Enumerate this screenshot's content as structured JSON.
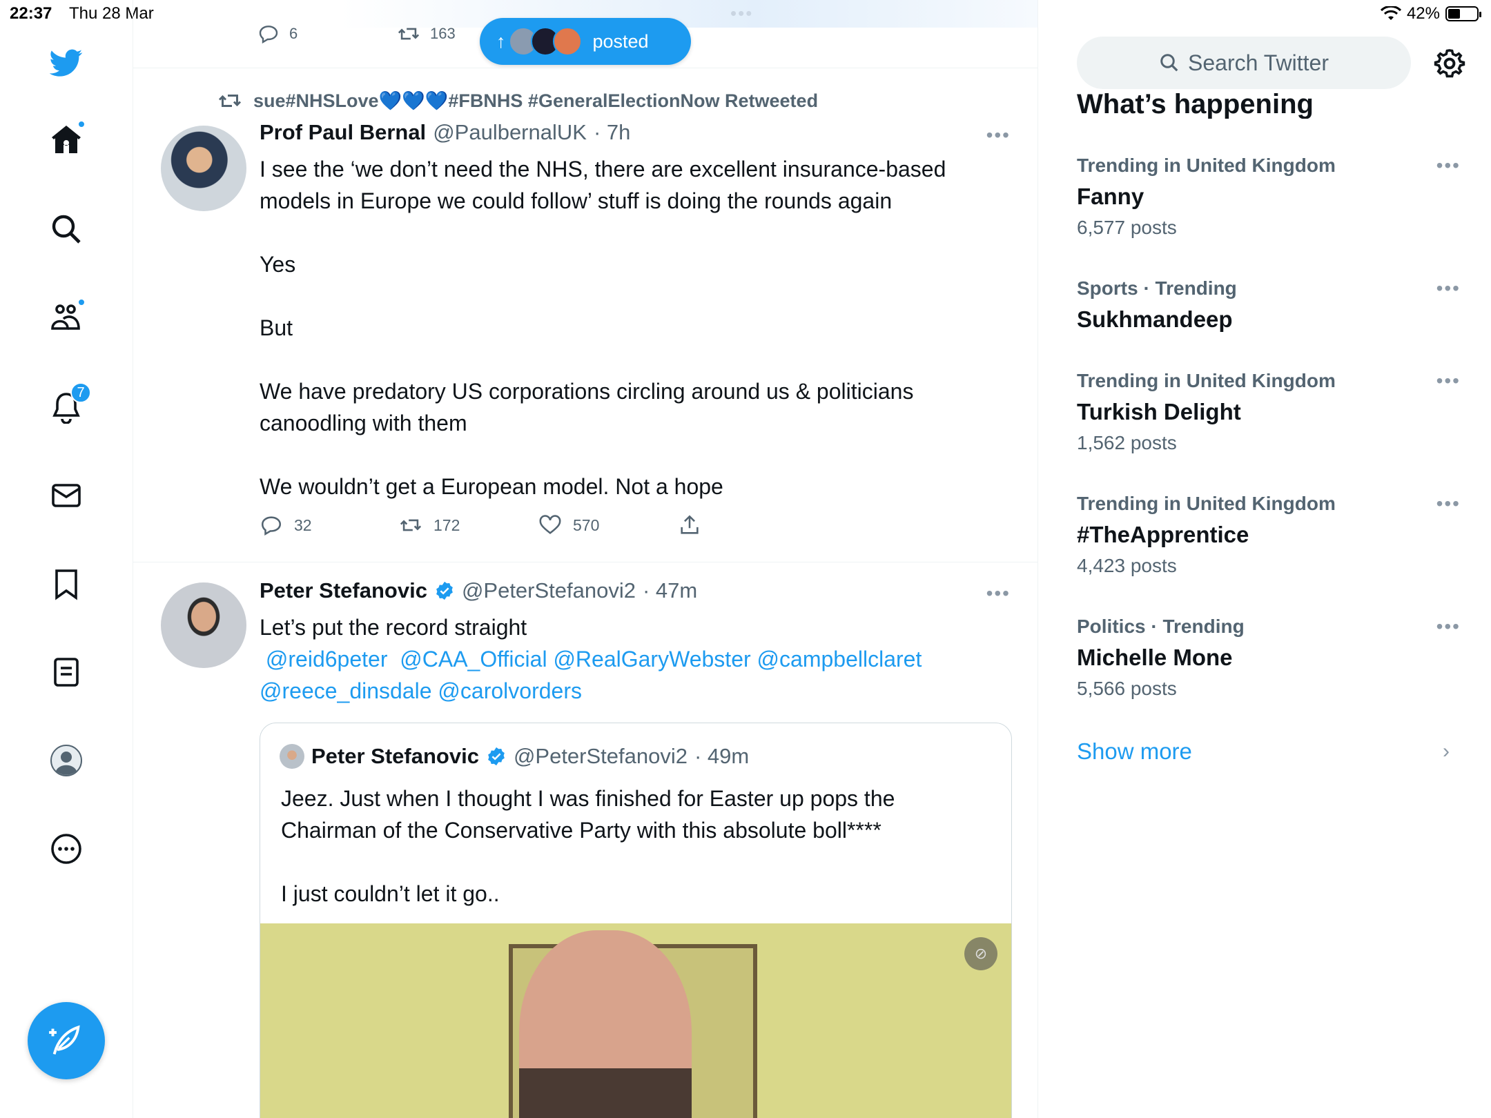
{
  "status_bar": {
    "time": "22:37",
    "date": "Thu 28 Mar",
    "dots": "•••",
    "battery": "42%",
    "battery_level": 0.42
  },
  "nav": {
    "items": [
      "twitter-logo",
      "home",
      "explore",
      "communities",
      "notifications",
      "messages",
      "bookmarks",
      "lists",
      "profile",
      "more"
    ],
    "notifications_badge": "7"
  },
  "prev_tweet": {
    "replies": "6",
    "retweets": "163"
  },
  "new_posts_pill": {
    "label": "posted"
  },
  "tweet1": {
    "retweeted_by": "sue#NHSLove💙💙💙#FBNHS #GeneralElectionNow Retweeted",
    "name": "Prof Paul Bernal",
    "handle": "@PaulbernalUK",
    "time": "· 7h",
    "body": "I see the ‘we don’t need the NHS, there are excellent insurance-based models in Europe we could follow’ stuff is doing the rounds again\n\nYes\n\nBut\n\nWe have predatory US corporations circling around us & politicians canoodling with them\n\nWe wouldn’t get a European model. Not a hope",
    "replies": "32",
    "retweets": "172",
    "likes": "570"
  },
  "tweet2": {
    "name": "Peter Stefanovic",
    "handle": "@PeterStefanovi2",
    "time": "· 47m",
    "body": "Let’s put the record straight",
    "mentions_line1": " @reid6peter  @CAA_Official @RealGaryWebster @campbellclaret",
    "mentions_line2": "@reece_dinsdale @carolvorders",
    "quote": {
      "name": "Peter Stefanovic",
      "handle": "@PeterStefanovi2",
      "time": "· 49m",
      "body": "Jeez. Just when I thought I was finished for Easter up pops the Chairman of the Conservative Party with this absolute boll****\n\nI just couldn’t let it go.."
    }
  },
  "sidebar": {
    "search_placeholder": "Search Twitter",
    "section_title": "What’s happening",
    "trends": [
      {
        "context": "Trending in United Kingdom",
        "topic": "Fanny",
        "count": "6,577 posts"
      },
      {
        "context": "Sports · Trending",
        "topic": "Sukhmandeep",
        "count": ""
      },
      {
        "context": "Trending in United Kingdom",
        "topic": "Turkish Delight",
        "count": "1,562 posts"
      },
      {
        "context": "Trending in United Kingdom",
        "topic": "#TheApprentice",
        "count": "4,423 posts"
      },
      {
        "context": "Politics · Trending",
        "topic": "Michelle Mone",
        "count": "5,566 posts"
      }
    ],
    "show_more": "Show more"
  },
  "colors": {
    "accent": "#1d9bf0",
    "text": "#0f1419",
    "muted": "#536471"
  }
}
